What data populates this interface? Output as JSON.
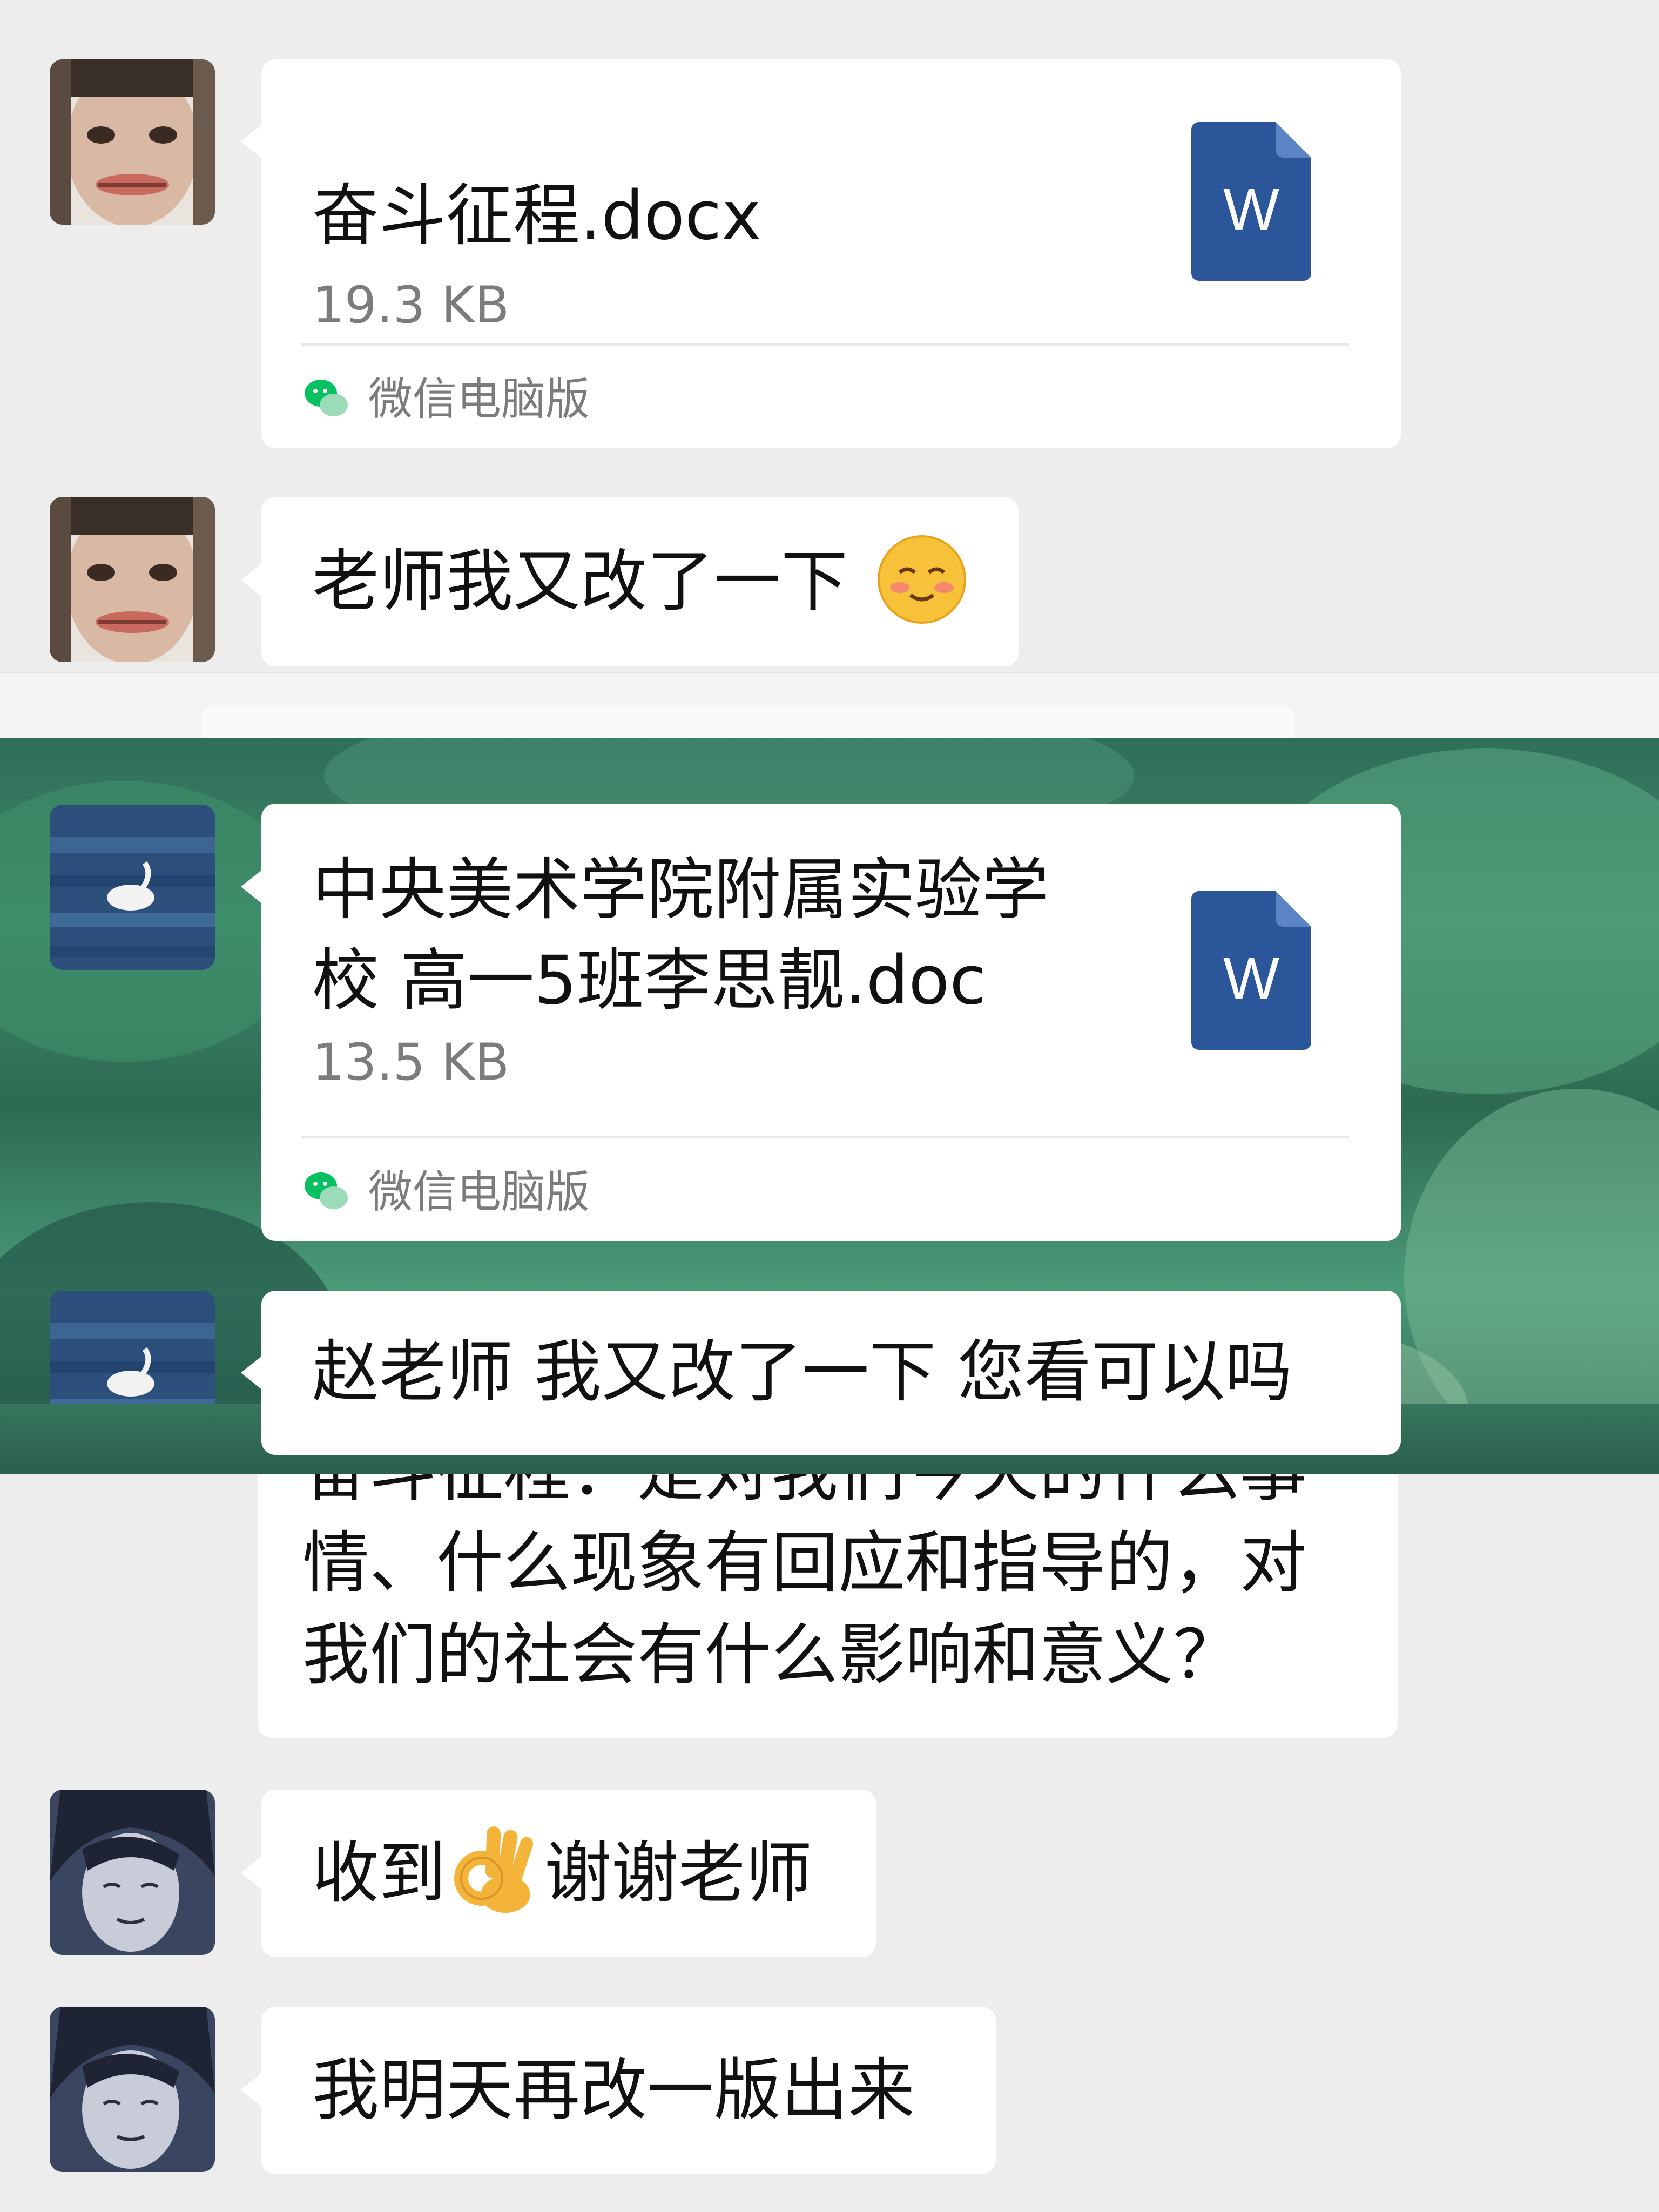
{
  "messages": [
    {
      "type": "file",
      "sender_avatar": "avatar-photo-face",
      "file_name": "奋斗征程.docx",
      "file_size": "19.3 KB",
      "file_icon": "word-doc-icon",
      "file_icon_letter": "W",
      "source": "微信电脑版",
      "source_icon": "wechat-icon"
    },
    {
      "type": "text",
      "sender_avatar": "avatar-photo-face",
      "text": "老师我又改了一下",
      "emoji": "blushing-face-emoji"
    },
    {
      "type": "file",
      "sender_avatar": "avatar-swan",
      "file_name_line1": "中央美术学院附属实验学",
      "file_name_line2": "校 高一5班李思靓.doc",
      "file_size": "13.5 KB",
      "file_icon": "word-doc-icon",
      "file_icon_letter": "W",
      "source": "微信电脑版",
      "source_icon": "wechat-icon"
    },
    {
      "type": "text",
      "sender_avatar": "avatar-swan",
      "text": "赵老师 我又改了一下 您看可以吗"
    },
    {
      "type": "text",
      "partially_hidden": true,
      "lines": [
        "奋斗征程：是对我们今天的什么事",
        "情、什么现象有回应和指导的，对",
        "我们的社会有什么影响和意义？"
      ]
    },
    {
      "type": "text",
      "sender_avatar": "avatar-anime",
      "text_before": "收到",
      "emoji": "ok-hand-emoji",
      "text_after": "谢谢老师"
    },
    {
      "type": "text",
      "sender_avatar": "avatar-anime",
      "text": "我明天再改一版出来"
    }
  ],
  "colors": {
    "chat_background": "#ededed",
    "bubble": "#ffffff",
    "word_blue": "#2b579a",
    "secondary_text": "#7c7c7c",
    "wechat_green": "#07c160"
  }
}
